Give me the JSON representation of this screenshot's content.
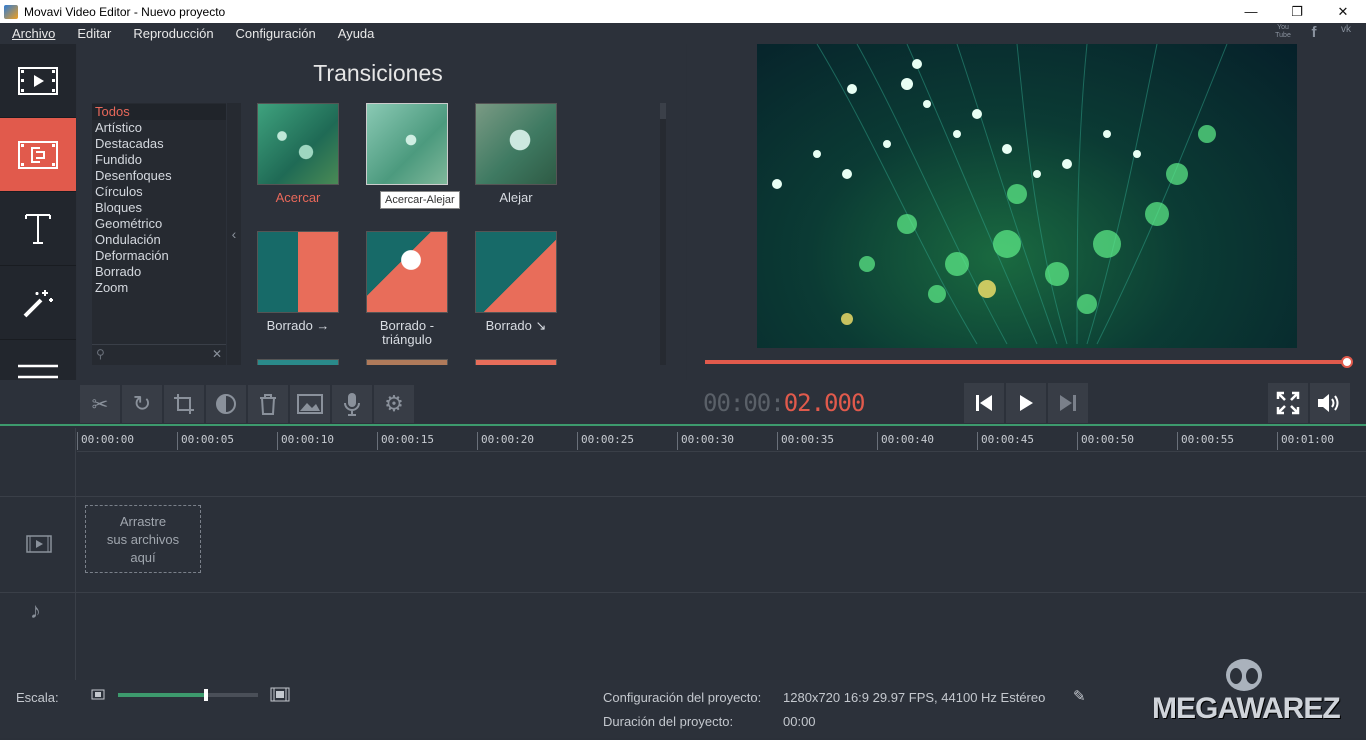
{
  "window": {
    "title": "Movavi Video Editor - Nuevo proyecto",
    "minimize": "—",
    "maximize": "❐",
    "close": "✕"
  },
  "menu": [
    "Archivo",
    "Editar",
    "Reproducción",
    "Configuración",
    "Ayuda"
  ],
  "social": [
    "You Tube",
    "f",
    "vk"
  ],
  "sidebar_tabs": [
    "media-import",
    "transitions",
    "titles",
    "filters",
    "more"
  ],
  "panel": {
    "title": "Transiciones",
    "categories": [
      "Todos",
      "Artístico",
      "Destacadas",
      "Fundido",
      "Desenfoques",
      "Círculos",
      "Bloques",
      "Geométrico",
      "Ondulación",
      "Deformación",
      "Borrado",
      "Zoom"
    ],
    "selected_category": "Todos",
    "collapse_arrow": "‹",
    "tiles": [
      {
        "label": "Acercar",
        "highlight": true
      },
      {
        "label": "Alejar",
        "highlight": false
      },
      {
        "label": "Alejar",
        "highlight": false
      },
      {
        "label": "Borrado →",
        "highlight": false
      },
      {
        "label": "Borrado - triángulo",
        "highlight": false
      },
      {
        "label": "Borrado ↘",
        "highlight": false
      }
    ],
    "tooltip": "Acercar-Alejar",
    "search_clear": "✕"
  },
  "timecode": {
    "dim": "00:00:",
    "active": "02.000"
  },
  "accent": "#e15a4c",
  "green": "#3d9a6d",
  "timeline": {
    "ticks": [
      "00:00:00",
      "00:00:05",
      "00:00:10",
      "00:00:15",
      "00:00:20",
      "00:00:25",
      "00:00:30",
      "00:00:35",
      "00:00:40",
      "00:00:45",
      "00:00:50",
      "00:00:55",
      "00:01:00"
    ],
    "dropzone": "Arrastre\nsus archivos\naquí",
    "music_note": "♪"
  },
  "status": {
    "scale_label": "Escala:",
    "zoom_level": 0.63,
    "config_label": "Configuración del proyecto:",
    "config_value": "1280x720 16:9 29.97 FPS, 44100 Hz Estéreo",
    "duration_label": "Duración del proyecto:",
    "duration_value": "00:00"
  },
  "watermark": "MEGAWAREZ"
}
